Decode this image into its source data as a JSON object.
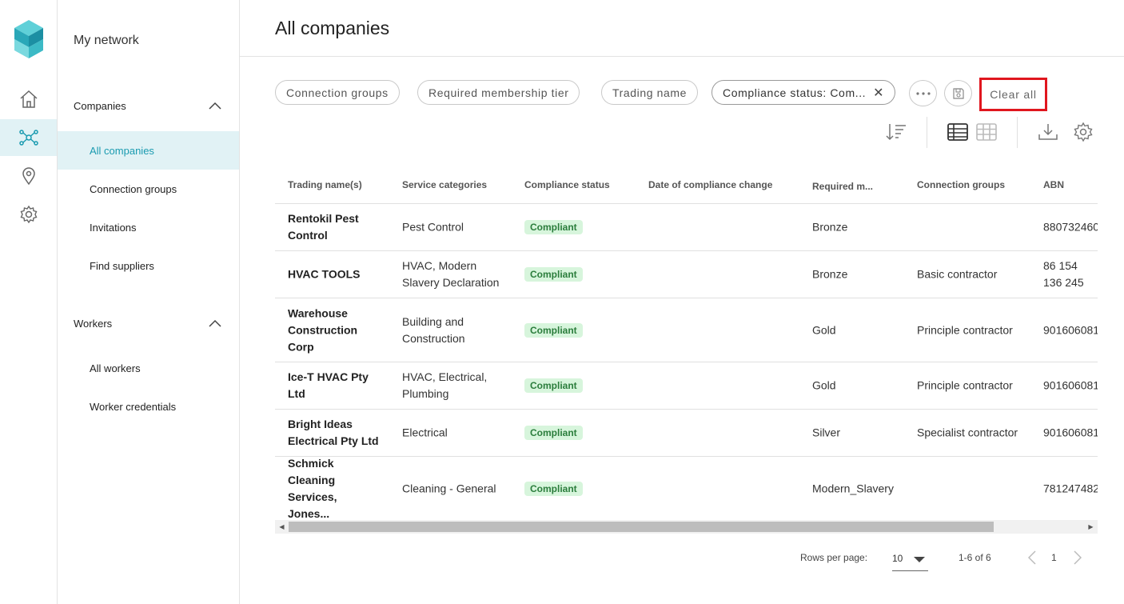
{
  "nav": {
    "title": "My network",
    "sections": [
      {
        "label": "Companies",
        "items": [
          "All companies",
          "Connection groups",
          "Invitations",
          "Find suppliers"
        ]
      },
      {
        "label": "Workers",
        "items": [
          "All workers",
          "Worker credentials"
        ]
      }
    ]
  },
  "page": {
    "title": "All companies"
  },
  "filters": {
    "chips": [
      "Connection groups",
      "Required membership tier",
      "Trading name",
      "Compliance status: Com..."
    ],
    "clear_all": "Clear all"
  },
  "table": {
    "headers": [
      "Trading name(s)",
      "Service categories",
      "Compliance status",
      "Date of compliance change",
      "Required m...",
      "Connection groups",
      "ABN"
    ],
    "rows": [
      {
        "name": "Rentokil Pest Control",
        "service": "Pest Control",
        "status": "Compliant",
        "date": "",
        "tier": "Bronze",
        "group": "",
        "abn": "880732460"
      },
      {
        "name": "HVAC TOOLS",
        "service": "HVAC, Modern Slavery Declaration",
        "status": "Compliant",
        "date": "",
        "tier": "Bronze",
        "group": "Basic contractor",
        "abn": "86 154 136 245"
      },
      {
        "name": "Warehouse Construction Corp",
        "service": "Building and Construction",
        "status": "Compliant",
        "date": "",
        "tier": "Gold",
        "group": "Principle contractor",
        "abn": "901606081"
      },
      {
        "name": "Ice-T HVAC Pty Ltd",
        "service": "HVAC, Electrical, Plumbing",
        "status": "Compliant",
        "date": "",
        "tier": "Gold",
        "group": "Principle contractor",
        "abn": "901606081"
      },
      {
        "name": "Bright Ideas Electrical Pty Ltd",
        "service": "Electrical",
        "status": "Compliant",
        "date": "",
        "tier": "Silver",
        "group": "Specialist contractor",
        "abn": "901606081"
      },
      {
        "name": "Schmick Cleaning Services, Jones...",
        "service": "Cleaning - General",
        "status": "Compliant",
        "date": "",
        "tier": "Modern_Slavery",
        "group": "",
        "abn": "781247482"
      }
    ]
  },
  "pagination": {
    "rows_per_page_label": "Rows per page:",
    "rows_per_page": "10",
    "range": "1-6 of 6",
    "page": "1"
  },
  "colors": {
    "accent": "#1a9bb0",
    "badge_bg": "#d7f5dc",
    "badge_text": "#2b7d3c",
    "highlight": "#e0161e"
  }
}
